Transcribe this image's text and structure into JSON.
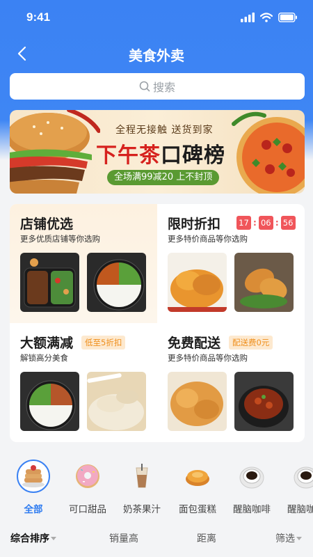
{
  "status_bar": {
    "time": "9:41"
  },
  "nav": {
    "title": "美食外卖"
  },
  "search": {
    "label": "搜索"
  },
  "banner": {
    "subtitle": "全程无接触 送货到家",
    "title_red": "下午茶",
    "title_dark": "口碑榜",
    "pill": "全场满99减20 上不封顶"
  },
  "promos": {
    "store": {
      "title": "店铺优选",
      "subtitle": "更多优质店铺等你选购"
    },
    "flash": {
      "title": "限时折扣",
      "subtitle": "更多特价商品等你选购",
      "hours": "17",
      "minutes": "06",
      "seconds": "56"
    },
    "discount": {
      "title": "大额满减",
      "tag": "低至5折扣",
      "subtitle": "解锁高分美食"
    },
    "delivery": {
      "title": "免费配送",
      "tag": "配送费0元",
      "subtitle": "更多特价商品等你选购"
    }
  },
  "categories": [
    {
      "label": "全部",
      "icon": "pancake-icon"
    },
    {
      "label": "可口甜品",
      "icon": "donut-icon"
    },
    {
      "label": "奶茶果汁",
      "icon": "milk-tea-icon"
    },
    {
      "label": "面包蛋糕",
      "icon": "bread-icon"
    },
    {
      "label": "醒脑咖啡",
      "icon": "coffee-icon"
    },
    {
      "label": "醒脑咖啡",
      "icon": "coffee-icon"
    }
  ],
  "sort": {
    "items": [
      "综合排序",
      "销量高",
      "距离",
      "筛选"
    ]
  },
  "colors": {
    "accent": "#3b82f3",
    "timer": "#f0555a",
    "tag": "#ef8f1c"
  }
}
